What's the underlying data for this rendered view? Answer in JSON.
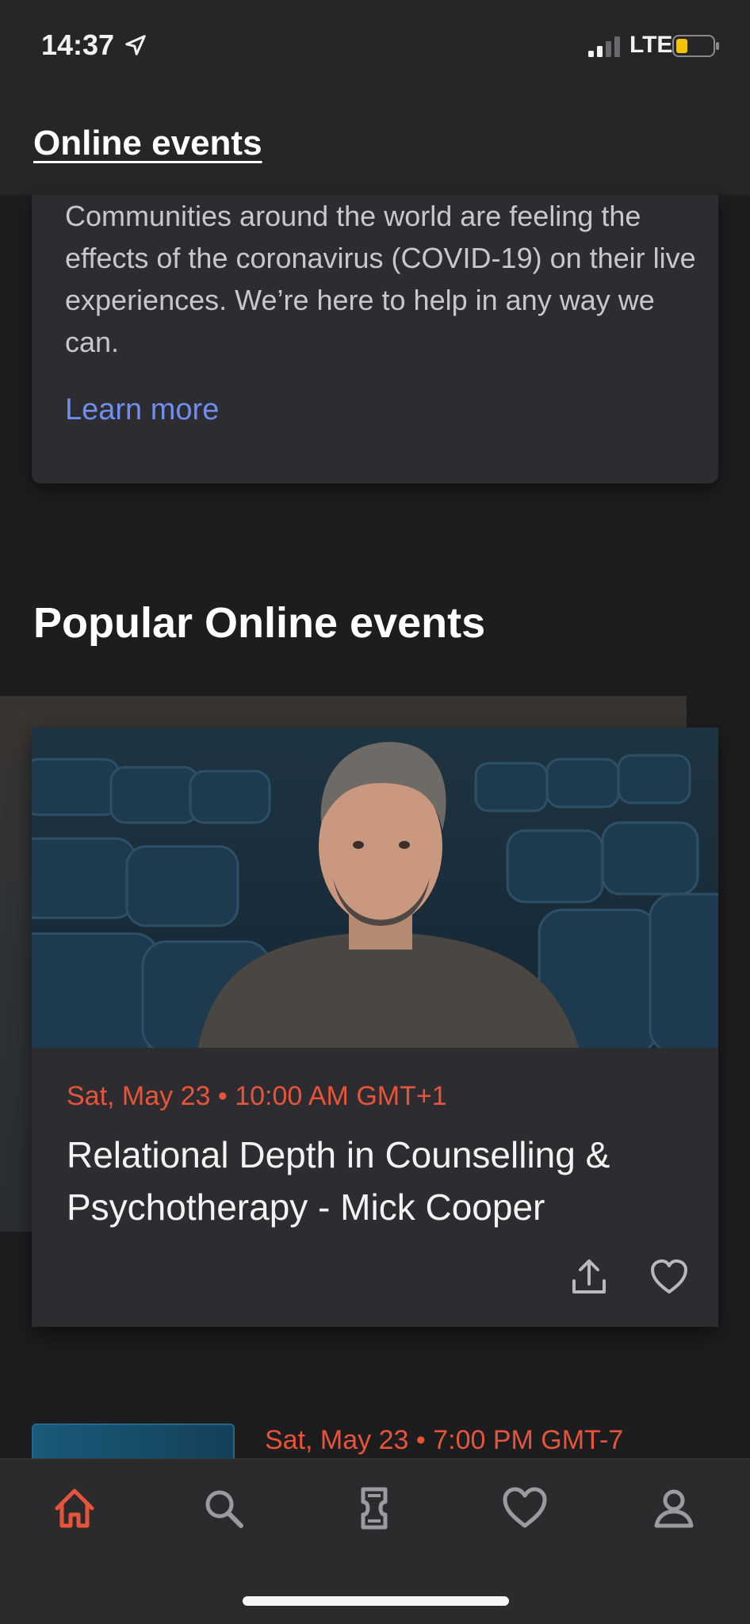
{
  "status_bar": {
    "time": "14:37",
    "network": "LTE",
    "battery_color": "#f5c400"
  },
  "header": {
    "title": "Online events"
  },
  "covid_card": {
    "text": "Communities around the world are feeling the effects of the coronavirus (COVID-19) on their live experiences. We’re here to help in any way we can.",
    "link": "Learn more"
  },
  "section": {
    "title": "Popular Online events"
  },
  "event": {
    "date": "Sat, May 23 • 10:00 AM GMT+1",
    "title": "Relational Depth in Counselling & Psychotherapy - Mick Cooper",
    "image_icon": "speaker-photo",
    "share_icon": "share-icon",
    "like_icon": "heart-icon"
  },
  "next_event": {
    "date": "Sat, May 23 • 7:00 PM GMT-7"
  },
  "tabbar": {
    "items": [
      {
        "name": "home",
        "icon": "home-icon",
        "active": true
      },
      {
        "name": "search",
        "icon": "search-icon",
        "active": false
      },
      {
        "name": "tickets",
        "icon": "ticket-icon",
        "active": false
      },
      {
        "name": "likes",
        "icon": "heart-icon",
        "active": false
      },
      {
        "name": "profile",
        "icon": "profile-icon",
        "active": false
      }
    ],
    "active_color": "#e8543a",
    "inactive_color": "#9a9aa0"
  },
  "colors": {
    "accent": "#e8543a",
    "link": "#6e8ff0",
    "background": "#1d1d20",
    "card": "#2d2d31"
  }
}
